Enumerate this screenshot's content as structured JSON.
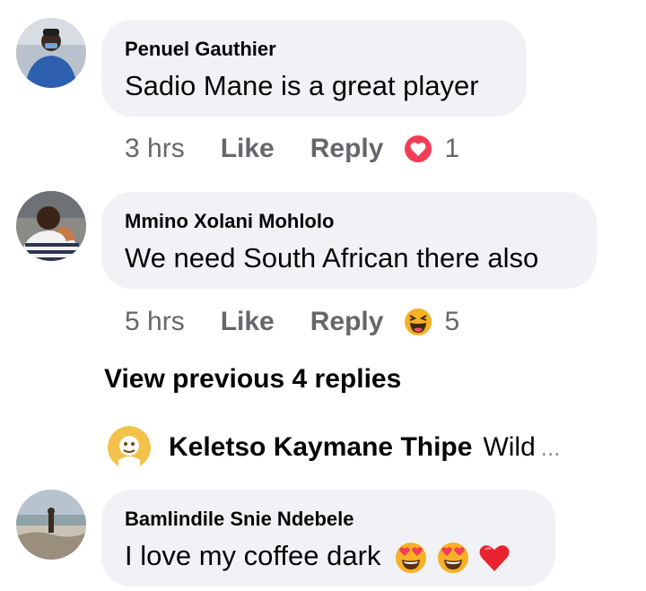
{
  "comments": [
    {
      "author": "Penuel Gauthier",
      "text": "Sadio Mane is a great player",
      "time": "3 hrs",
      "like_label": "Like",
      "reply_label": "Reply",
      "reaction_icon": "love-reaction-icon",
      "reaction_count": "1"
    },
    {
      "author": "Mmino Xolani Mohlolo",
      "text": "We need South African there also",
      "time": "5 hrs",
      "like_label": "Like",
      "reply_label": "Reply",
      "reaction_icon": "haha-reaction-icon",
      "reaction_count": "5"
    },
    {
      "author": "Bamlindile Snie Ndebele",
      "text": "I love my coffee dark",
      "emojis": [
        "heart-eyes-emoji",
        "heart-eyes-emoji",
        "red-heart-emoji"
      ]
    }
  ],
  "view_previous_label": "View previous 4 replies",
  "collapsed_reply": {
    "author": "Keletso Kaymane Thipe",
    "snippet": "Wild",
    "ellipsis": "..."
  },
  "colors": {
    "bubble": "#f0f2f5",
    "secondary_text": "#65676b",
    "love_red": "#f33e58",
    "haha_yellow": "#f7b125"
  }
}
